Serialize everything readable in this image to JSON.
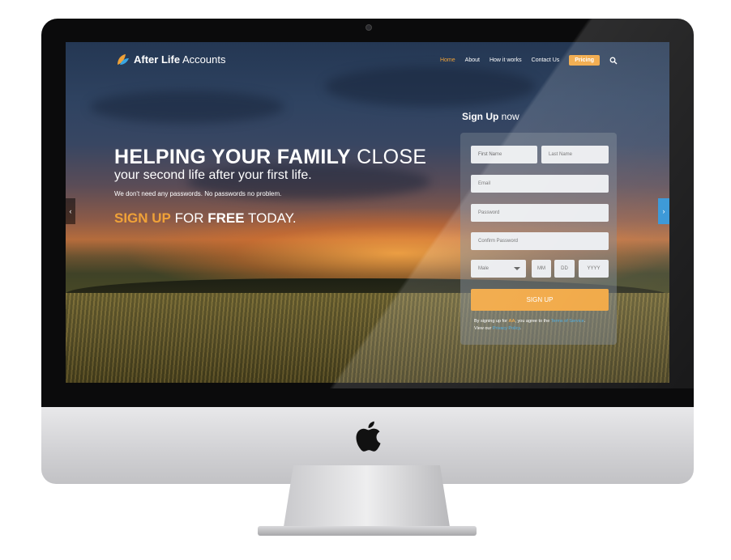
{
  "site": {
    "brand_bold": "After Life",
    "brand_light": "Accounts",
    "nav": [
      {
        "label": "Home",
        "active": true
      },
      {
        "label": "About"
      },
      {
        "label": "How it works"
      },
      {
        "label": "Contact Us"
      }
    ],
    "nav_pricing": "Pricing",
    "search_icon": "search-icon"
  },
  "hero": {
    "title_bold": "HELPING YOUR FAMILY",
    "title_light": "CLOSE",
    "subtitle": "your second life after your first life.",
    "note": "We don't need any passwords. No passwords no problem.",
    "cta_part1": "SIGN UP",
    "cta_part2": "FOR",
    "cta_part3": "FREE",
    "cta_part4": "TODAY."
  },
  "signup": {
    "title_bold": "Sign Up",
    "title_light": "now",
    "first_name": "First Name",
    "last_name": "Last Name",
    "email": "Email",
    "password": "Password",
    "confirm_password": "Confirm Password",
    "gender": "Male",
    "mm": "MM",
    "dd": "DD",
    "yyyy": "YYYY",
    "button": "SIGN UP",
    "terms_1": "By signing up for",
    "terms_aa": "AA",
    "terms_2": ", you agree to the",
    "terms_link": "Terms of Service",
    "terms_3": ".",
    "terms_4": "View our",
    "privacy_link": "Privacy Policy",
    "terms_5": "."
  },
  "colors": {
    "accent": "#f0a238",
    "link": "#3aa6e2",
    "slider_arrow_active": "#2a8fd4"
  },
  "icons": [
    "apple-logo-icon",
    "leaf-logo-icon",
    "search-icon",
    "chevron-left-icon",
    "chevron-right-icon",
    "chevron-down-icon"
  ]
}
